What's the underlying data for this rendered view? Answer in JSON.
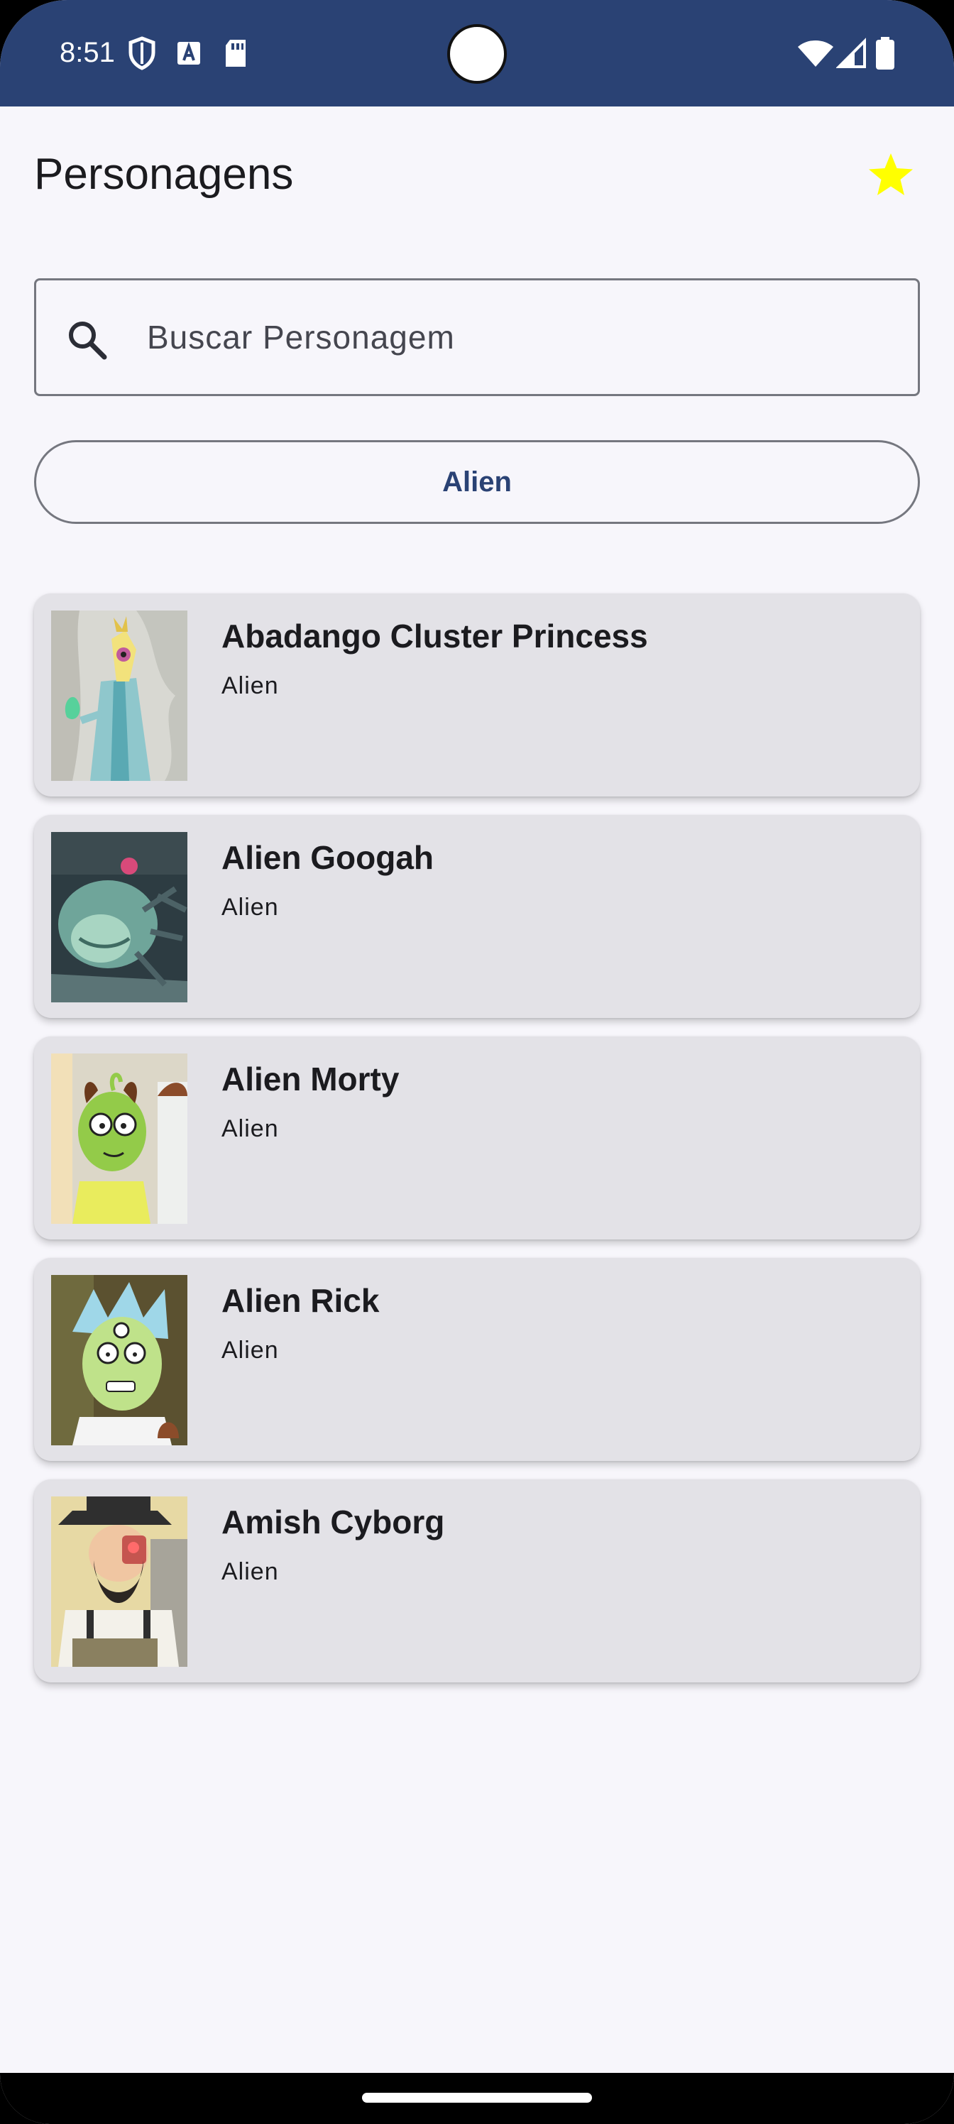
{
  "status_bar": {
    "time": "8:51",
    "left_icons": [
      "shield-icon",
      "text-a-icon",
      "sd-card-icon"
    ],
    "right_icons": [
      "wifi-icon",
      "signal-icon",
      "battery-icon"
    ],
    "background": "#2a4274"
  },
  "header": {
    "title": "Personagens",
    "favorites_icon": "star-icon",
    "favorites_color": "#ffff00"
  },
  "search": {
    "placeholder": "Buscar Personagem",
    "value": "",
    "icon": "search-icon"
  },
  "filter": {
    "label": "Alien"
  },
  "characters": [
    {
      "name": "Abadango Cluster Princess",
      "species": "Alien"
    },
    {
      "name": "Alien Googah",
      "species": "Alien"
    },
    {
      "name": "Alien Morty",
      "species": "Alien"
    },
    {
      "name": "Alien Rick",
      "species": "Alien"
    },
    {
      "name": "Amish Cyborg",
      "species": "Alien"
    }
  ],
  "colors": {
    "background": "#f7f6fb",
    "card": "#e3e2e7",
    "primary": "#2a4274",
    "outline": "#75777f"
  }
}
